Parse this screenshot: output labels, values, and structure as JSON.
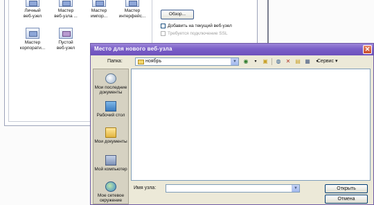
{
  "background_dialog": {
    "templates_row1": [
      "Личный\nвеб-узел",
      "Мастер\nвеб-узла ...",
      "Мастер\nимпор...",
      "Мастер\nинтерфейс..."
    ],
    "templates_row2": [
      "Мастер\nкорпорати...",
      "Пустой\nвеб-узел"
    ],
    "browse_button": "Обзор...",
    "add_to_current_checkbox": "Добавить на текущий веб-узел",
    "ssl_checkbox": "Требуется подключение SSL"
  },
  "dialog": {
    "title": "Место для нового веб-узла",
    "folder_label": "Папка:",
    "folder_value": "ноябрь",
    "tools_label": "Сервис",
    "places": [
      "Мои последние документы",
      "Рабочий стол",
      "Мои документы",
      "Мой компьютер",
      "Мое сетевое окружение"
    ],
    "site_name_label": "Имя узла:",
    "site_name_value": "",
    "open_button": "Открыть",
    "cancel_button": "Отмена"
  },
  "colors": {
    "title_bar": "#7a5fc8",
    "dialog_face": "#ece9d8"
  }
}
